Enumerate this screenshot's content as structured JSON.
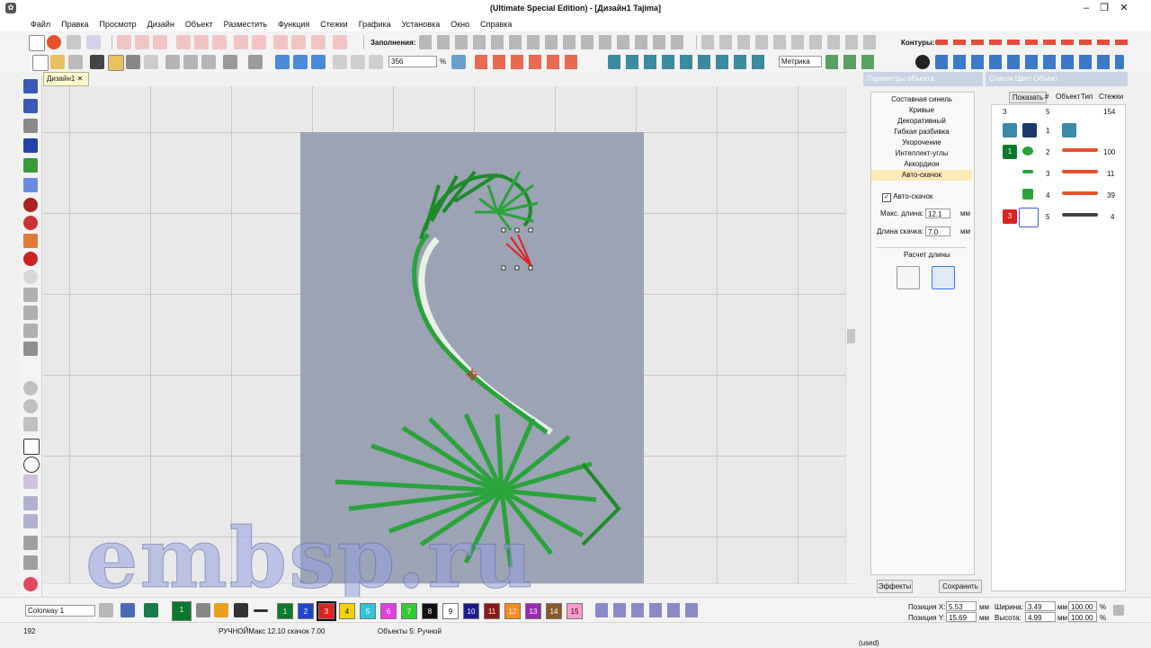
{
  "window": {
    "title": "(Ultimate Special Edition) - [Дизайн1     Tajima]"
  },
  "menu": [
    "Файл",
    "Правка",
    "Просмотр",
    "Дизайн",
    "Объект",
    "Разместить",
    "Функция",
    "Стежки",
    "Графика",
    "Установка",
    "Окно",
    "Справка"
  ],
  "toolbar1": {
    "fills_label": "Заполнения:",
    "contours_label": "Контуры:"
  },
  "toolbar2": {
    "zoom_value": "356",
    "zoom_unit": "%",
    "units_value": "Метрика"
  },
  "doc_tab": {
    "label": "Дизайн1"
  },
  "properties_panel": {
    "title": "Параметры объекта",
    "effects": [
      "Составная синель",
      "Кривые",
      "Декоративный",
      "Гибкая разбивка",
      "Укорочение",
      "Интеллект-углы",
      "Аккордион",
      "Авто-скачок"
    ],
    "selected_effect": "Авто-скачок",
    "auto_jump_checkbox": "Авто-скачок",
    "max_len_label": "Макс. длина:",
    "max_len_value": "12.1",
    "jump_len_label": "Длина скачка:",
    "jump_len_value": "7.0",
    "unit": "мм",
    "calc_label": "Расчет длины",
    "effects_button": "Эффекты",
    "save_button": "Сохранить"
  },
  "color_list_panel": {
    "title": "Список Цвет-Объект",
    "columns": [
      "Показать",
      "#",
      "Объект",
      "Тип",
      "Стежки"
    ],
    "summary": {
      "colors": "3",
      "objects": "5",
      "stitches": "154"
    },
    "rows": [
      {
        "num": "1",
        "stitches": ""
      },
      {
        "num": "2",
        "stitches": "100"
      },
      {
        "num": "3",
        "stitches": "11"
      },
      {
        "num": "4",
        "stitches": "39"
      },
      {
        "num": "5",
        "stitches": "4"
      }
    ],
    "color_badges": [
      "1",
      "3"
    ]
  },
  "bottom": {
    "colorway": "Colorway 1",
    "current_color": "1",
    "swatches": [
      {
        "n": "1",
        "c": "#0a7a2a"
      },
      {
        "n": "2",
        "c": "#2244cc"
      },
      {
        "n": "3",
        "c": "#dd2222"
      },
      {
        "n": "4",
        "c": "#f2d200"
      },
      {
        "n": "5",
        "c": "#33c3d6"
      },
      {
        "n": "6",
        "c": "#e040e0"
      },
      {
        "n": "7",
        "c": "#33cc33"
      },
      {
        "n": "8",
        "c": "#111111"
      },
      {
        "n": "9",
        "c": "#ffffff"
      },
      {
        "n": "10",
        "c": "#1a1a8a"
      },
      {
        "n": "11",
        "c": "#8a1a1a"
      },
      {
        "n": "12",
        "c": "#ff8a22"
      },
      {
        "n": "13",
        "c": "#9a2ab0"
      },
      {
        "n": "14",
        "c": "#8a5a2a"
      },
      {
        "n": "15",
        "c": "#ff9ad0"
      }
    ],
    "pos_x_label": "Позиция X:",
    "pos_x_value": "5.53",
    "pos_y_label": "Позиция Y:",
    "pos_y_value": "15.69",
    "width_label": "Ширина:",
    "width_value": "3.49",
    "height_label": "Высота:",
    "height_value": "4.99",
    "unit": "мм",
    "pct1": "100.00",
    "pct2": "100.00",
    "pct_unit": "%"
  },
  "status": {
    "left": "192",
    "mode": "РУЧНОЙМакс 12.10 скачок 7.00",
    "objects": "Объекты 5: Ручной",
    "right": "(used)"
  },
  "watermark": "embsp.ru"
}
